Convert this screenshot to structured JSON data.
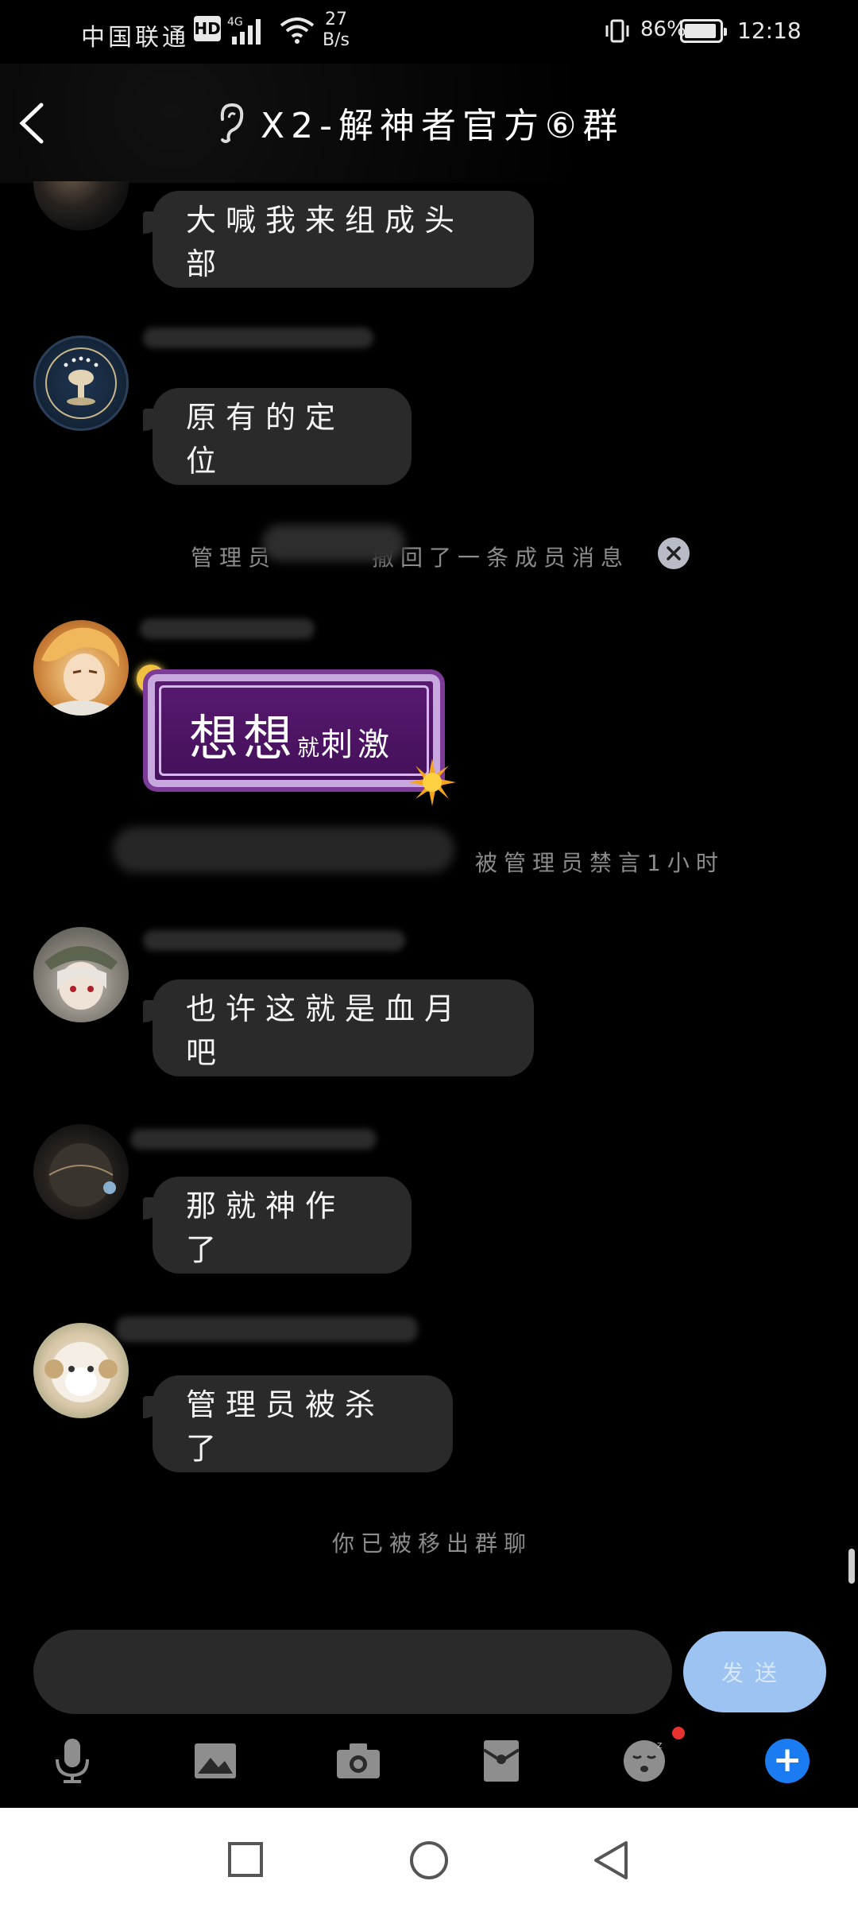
{
  "status_bar": {
    "carrier": "中国联通",
    "hd": "HD",
    "network": "4G",
    "speed_value": "27",
    "speed_unit": "B/s",
    "battery": "86%",
    "time": "12:18"
  },
  "header": {
    "title": "X2-解神者官方⑥群"
  },
  "messages": [
    {
      "type": "text",
      "text": "大喊我来组成头部"
    },
    {
      "type": "text",
      "text": "原有的定位"
    },
    {
      "type": "system_recall",
      "prefix": "管理员",
      "suffix": "撤回了一条成员消息"
    },
    {
      "type": "sticker_card",
      "big": "想想",
      "small": "就",
      "tail": "刺激"
    },
    {
      "type": "system_mute",
      "text": "被管理员禁言1小时"
    },
    {
      "type": "text",
      "text": "也许这就是血月吧"
    },
    {
      "type": "text",
      "text": "那就神作了"
    },
    {
      "type": "text",
      "text": "管理员被杀了"
    }
  ],
  "footer_notice": "你已被移出群聊",
  "composer": {
    "send_label": "发送"
  },
  "toolbar": {
    "icons": [
      "mic-icon",
      "image-icon",
      "camera-icon",
      "red-packet-icon",
      "emoji-icon",
      "plus-icon"
    ]
  },
  "colors": {
    "bubble": "#2a2a2a",
    "send_button": "#9cc3f2",
    "plus_button": "#1a7cf0",
    "badge": "#e8322f",
    "card": "#5a1a72"
  }
}
